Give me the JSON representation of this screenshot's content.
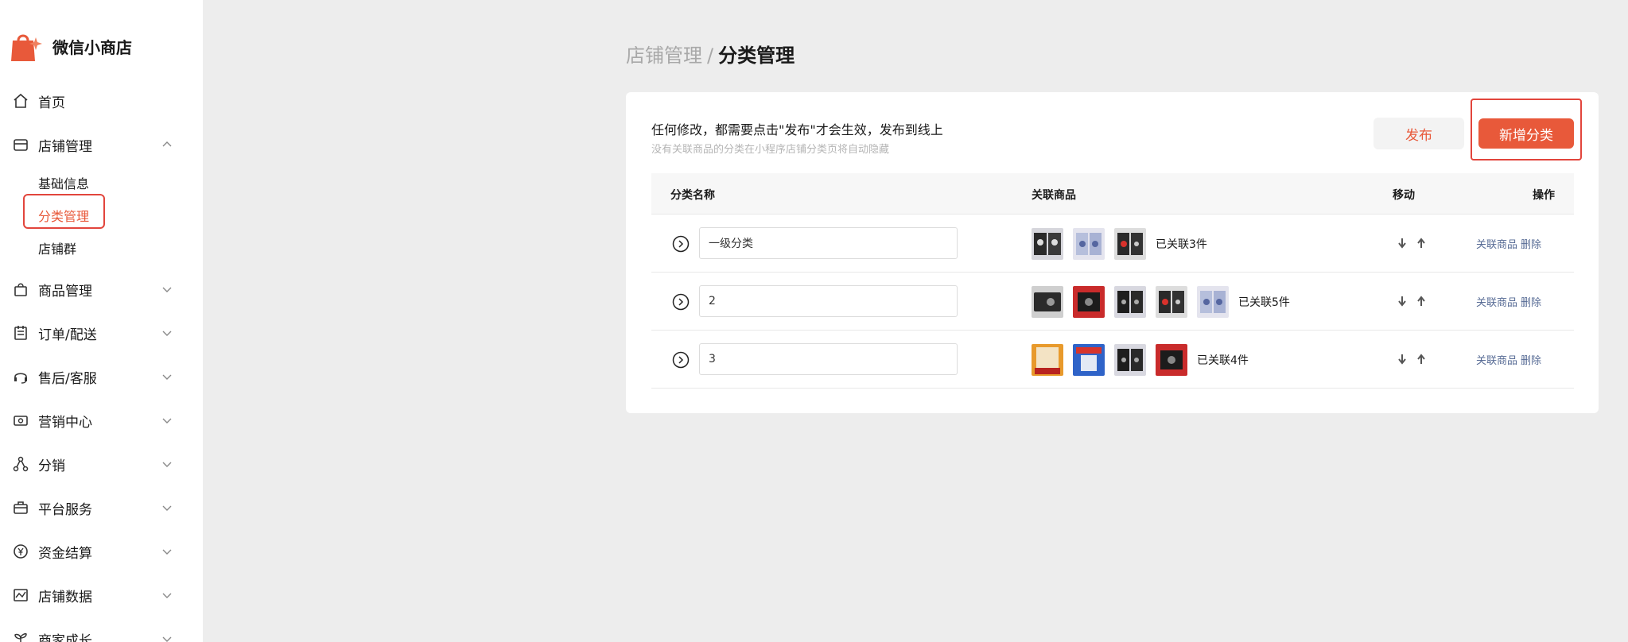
{
  "brand": {
    "name": "微信小商店",
    "accent": "#e8593a"
  },
  "nav": {
    "home": "首页",
    "store_mgmt": "店铺管理",
    "store_sub": [
      "基础信息",
      "分类管理",
      "店铺群"
    ],
    "goods": "商品管理",
    "orders": "订单/配送",
    "aftersale": "售后/客服",
    "marketing": "营销中心",
    "distribution": "分销",
    "platform": "平台服务",
    "finance": "资金结算",
    "data": "店铺数据",
    "growth": "商家成长"
  },
  "breadcrumb": {
    "parent": "店铺管理",
    "sep": "/",
    "current": "分类管理"
  },
  "notice": {
    "title": "任何修改，都需要点击\"发布\"才会生效，发布到线上",
    "sub": "没有关联商品的分类在小程序店铺分类页将自动隐藏"
  },
  "buttons": {
    "publish": "发布",
    "add": "新增分类"
  },
  "table": {
    "headers": {
      "name": "分类名称",
      "goods": "关联商品",
      "move": "移动",
      "ops": "操作"
    },
    "rows": [
      {
        "name": "一级分类",
        "linked": "已关联3件",
        "thumbs": [
          "skull-card",
          "blue-card",
          "red-card"
        ]
      },
      {
        "name": "2",
        "linked": "已关联5件",
        "thumbs": [
          "black-card",
          "red-case",
          "dark-card",
          "red-card",
          "blue-card"
        ]
      },
      {
        "name": "3",
        "linked": "已关联4件",
        "thumbs": [
          "orange-box",
          "blue-box",
          "dark-card",
          "red-case"
        ]
      }
    ],
    "ops": {
      "link": "关联商品",
      "delete": "删除"
    }
  }
}
